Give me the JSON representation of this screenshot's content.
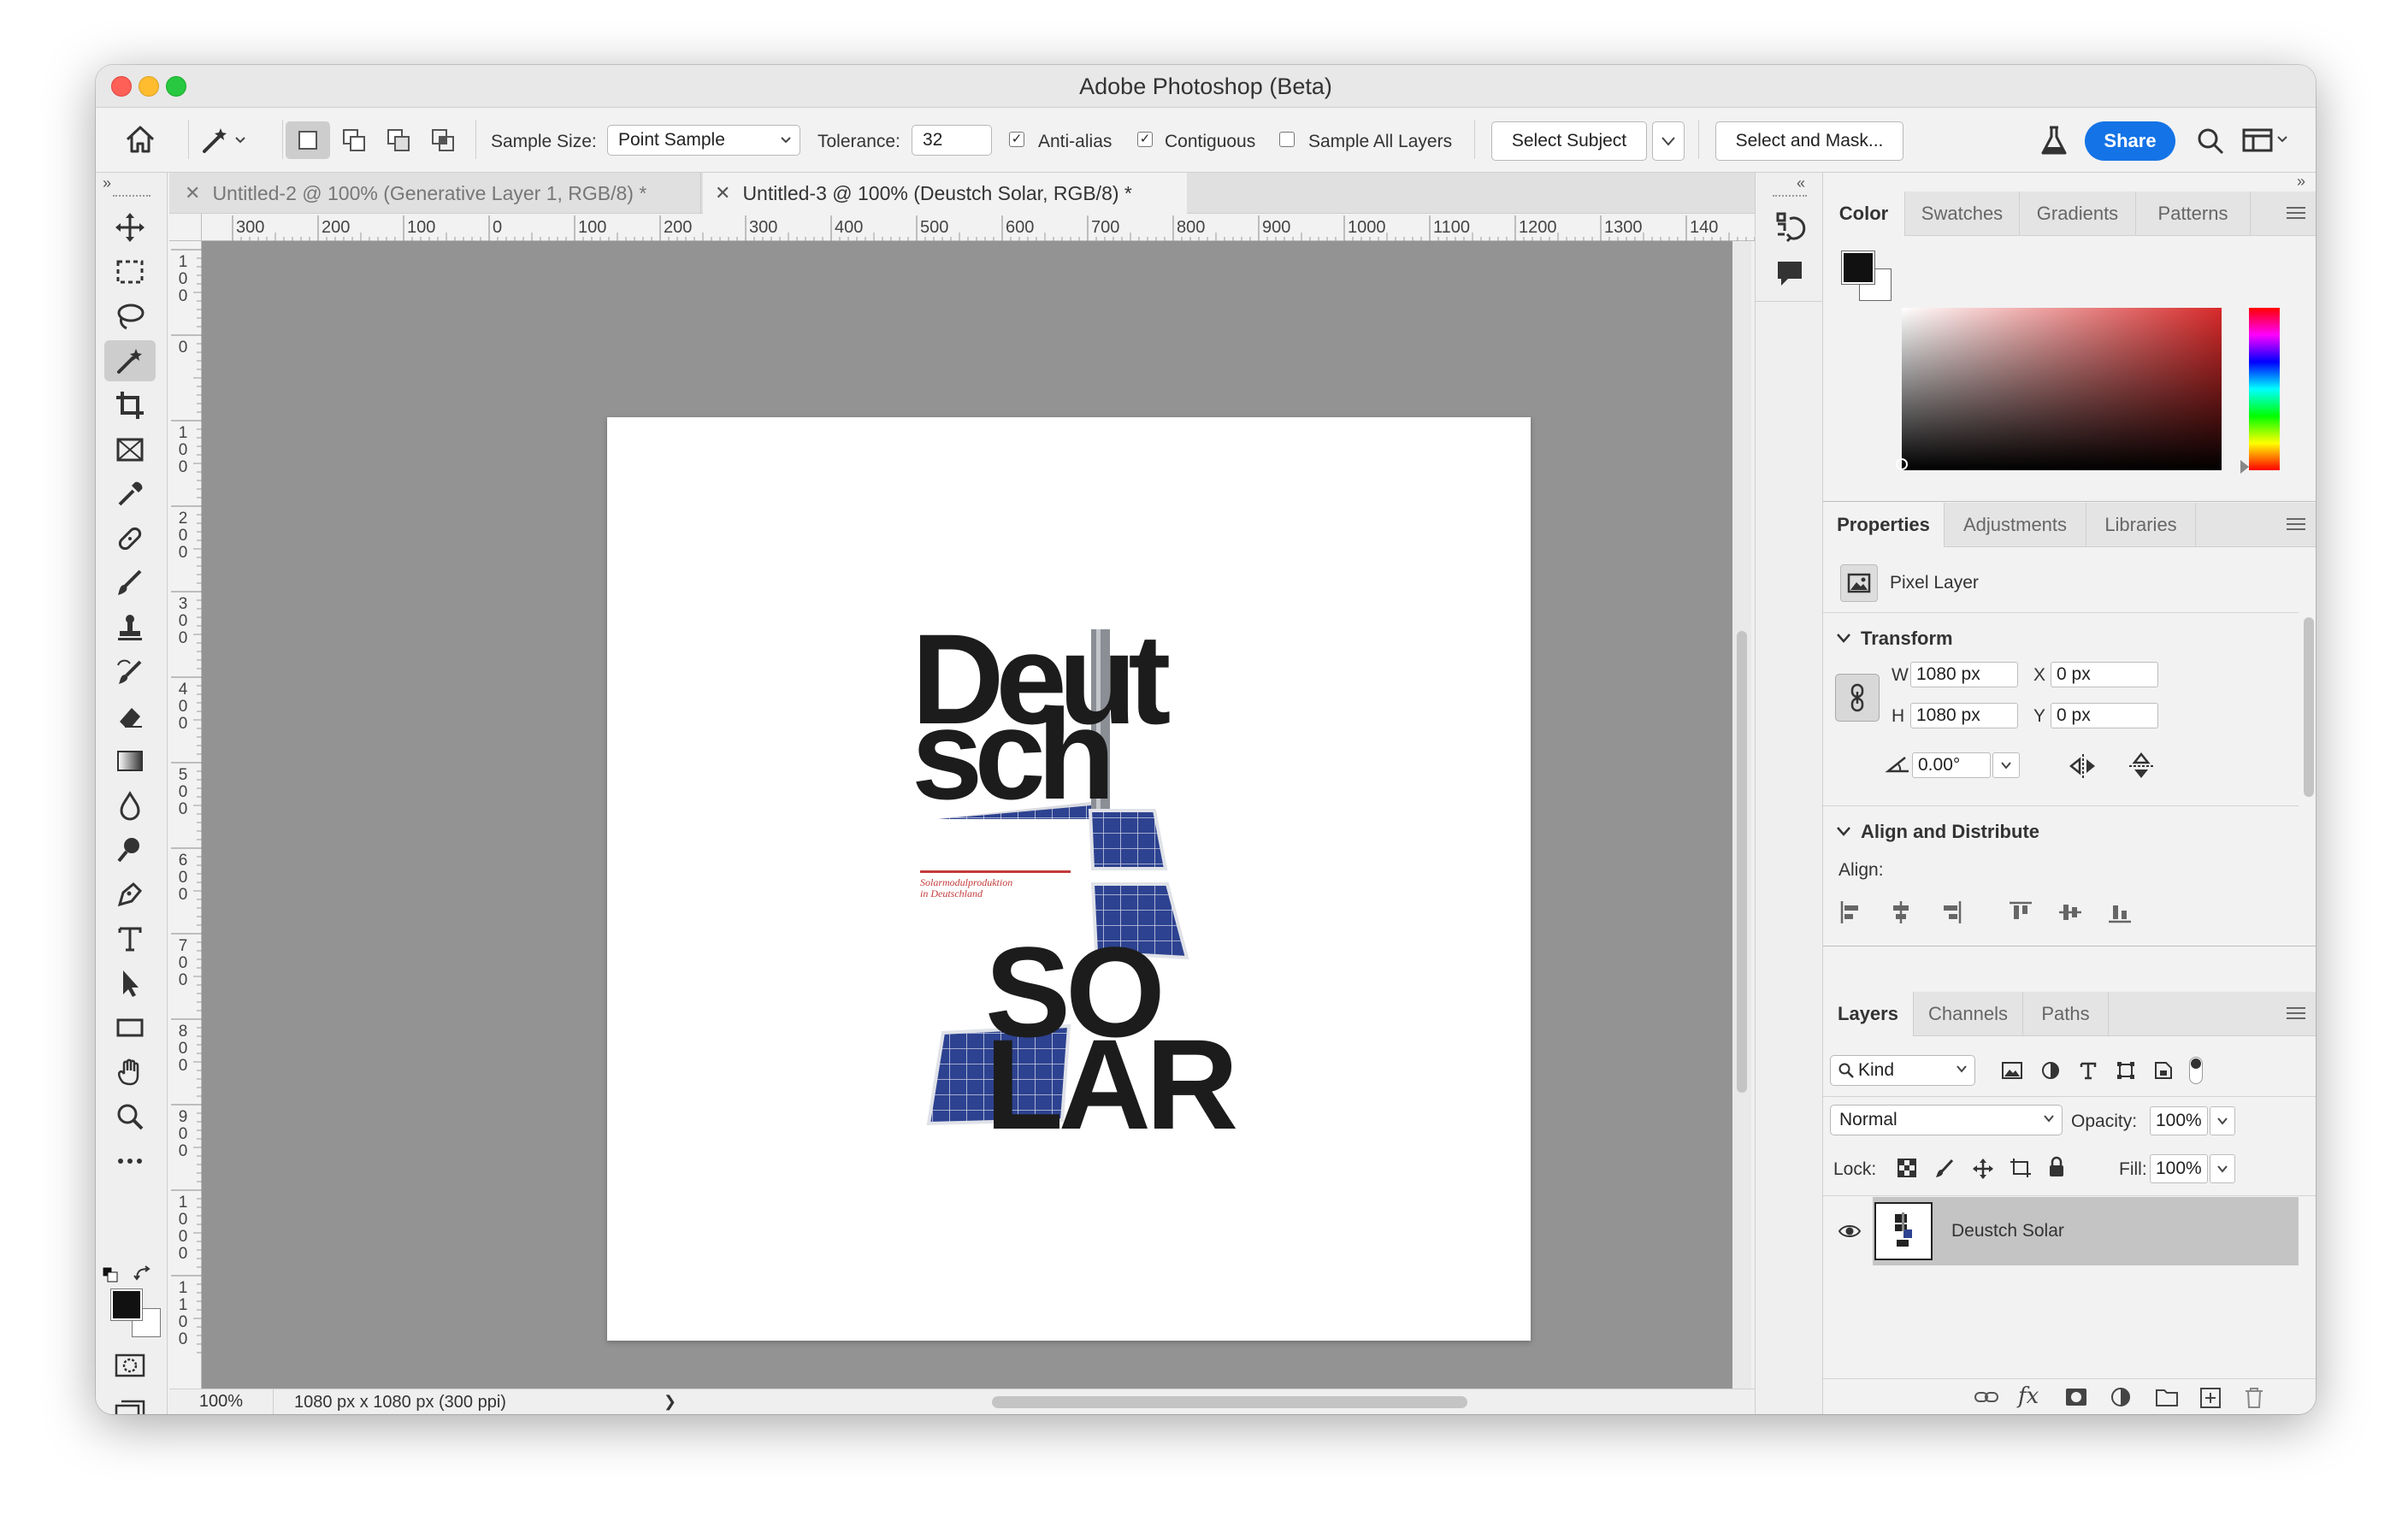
{
  "window": {
    "title": "Adobe Photoshop (Beta)"
  },
  "options": {
    "sample_size_label": "Sample Size:",
    "sample_size_value": "Point Sample",
    "tolerance_label": "Tolerance:",
    "tolerance_value": "32",
    "anti_alias_label": "Anti-alias",
    "anti_alias_checked": true,
    "contiguous_label": "Contiguous",
    "contiguous_checked": true,
    "sample_all_label": "Sample All Layers",
    "sample_all_checked": false,
    "select_subject": "Select Subject",
    "select_mask": "Select and Mask...",
    "share": "Share"
  },
  "tabs": [
    {
      "label": "Untitled-2 @ 100% (Generative Layer 1, RGB/8) *",
      "active": false
    },
    {
      "label": "Untitled-3 @ 100% (Deustch Solar, RGB/8) *",
      "active": true
    }
  ],
  "ruler": {
    "h_labels": [
      "300",
      "200",
      "100",
      "0",
      "100",
      "200",
      "300",
      "400",
      "500",
      "600",
      "700",
      "800",
      "900",
      "1000",
      "1100",
      "1200",
      "1300",
      "140"
    ],
    "v_labels": [
      "100",
      "0",
      "100",
      "200",
      "300",
      "400",
      "500",
      "600",
      "700",
      "800",
      "900",
      "1000",
      "1100"
    ]
  },
  "artwork": {
    "line1": "Deut",
    "line2": "sch",
    "line3": "SO",
    "line4": "LAR",
    "caption1": "Solarmodulproduktion",
    "caption2": "in Deutschland"
  },
  "status": {
    "zoom": "100%",
    "doc_info": "1080 px x 1080 px (300 ppi)",
    "arrow": "❯"
  },
  "color_panel": {
    "tabs": [
      "Color",
      "Swatches",
      "Gradients",
      "Patterns"
    ],
    "active": "Color",
    "hue": "#d82a2a"
  },
  "properties": {
    "tabs": [
      "Properties",
      "Adjustments",
      "Libraries"
    ],
    "active": "Properties",
    "layer_type": "Pixel Layer",
    "transform_label": "Transform",
    "w_label": "W",
    "w_value": "1080 px",
    "h_label": "H",
    "h_value": "1080 px",
    "x_label": "X",
    "x_value": "0 px",
    "y_label": "Y",
    "y_value": "0 px",
    "angle_value": "0.00°",
    "align_label": "Align and Distribute",
    "align_sub": "Align:"
  },
  "layers": {
    "tabs": [
      "Layers",
      "Channels",
      "Paths"
    ],
    "active": "Layers",
    "kind_label": "Kind",
    "blend_mode": "Normal",
    "opacity_label": "Opacity:",
    "opacity_value": "100%",
    "lock_label": "Lock:",
    "fill_label": "Fill:",
    "fill_value": "100%",
    "items": [
      {
        "name": "Deustch Solar",
        "visible": true,
        "selected": true
      }
    ]
  },
  "colors": {
    "accent": "#1473e6",
    "caption_red": "#c43a3a",
    "panel_blue": "#2a3f8c"
  }
}
